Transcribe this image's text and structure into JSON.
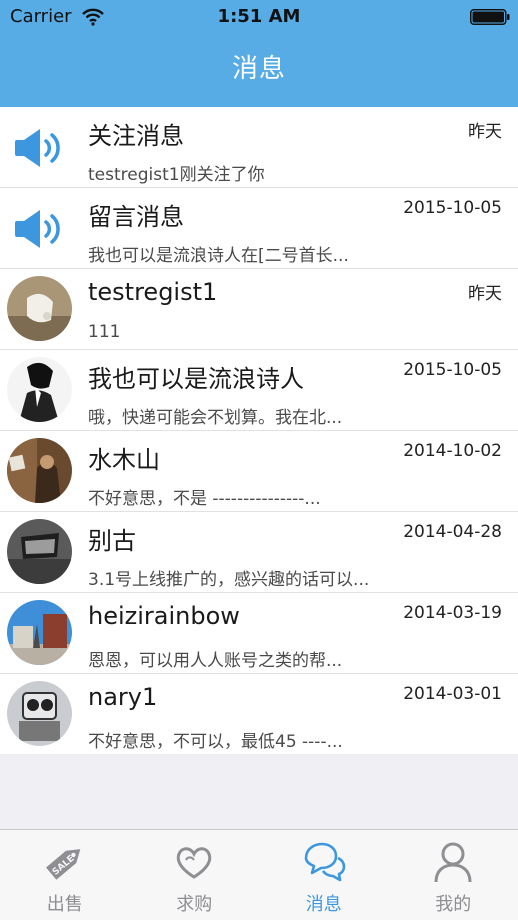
{
  "status_bar": {
    "carrier": "Carrier",
    "time": "1:51 AM"
  },
  "nav": {
    "title": "消息"
  },
  "messages": [
    {
      "avatar": "speaker-icon",
      "name": "关注消息",
      "time": "昨天",
      "preview": "testregist1刚关注了你"
    },
    {
      "avatar": "speaker-icon",
      "name": "留言消息",
      "time": "2015-10-05",
      "preview": "我也可以是流浪诗人在[二号首长..."
    },
    {
      "avatar": "photo",
      "name": "testregist1",
      "time": "昨天",
      "preview": "111"
    },
    {
      "avatar": "photo",
      "name": "我也可以是流浪诗人",
      "time": "2015-10-05",
      "preview": "哦，快递可能会不划算。我在北..."
    },
    {
      "avatar": "photo",
      "name": "水木山",
      "time": "2014-10-02",
      "preview": "不好意思，不是 ---------------..."
    },
    {
      "avatar": "photo",
      "name": "别古",
      "time": "2014-04-28",
      "preview": "3.1号上线推广的，感兴趣的话可以..."
    },
    {
      "avatar": "photo",
      "name": "heizirainbow",
      "time": "2014-03-19",
      "preview": "恩恩，可以用人人账号之类的帮..."
    },
    {
      "avatar": "photo",
      "name": "nary1",
      "time": "2014-03-01",
      "preview": "不好意思，不可以，最低45 ----..."
    }
  ],
  "tabs": [
    {
      "label": "出售",
      "icon": "sale-tag-icon",
      "icon_text": "SALE",
      "active": false
    },
    {
      "label": "求购",
      "icon": "heart-icon",
      "active": false
    },
    {
      "label": "消息",
      "icon": "chat-bubbles-icon",
      "active": true
    },
    {
      "label": "我的",
      "icon": "person-icon",
      "active": false
    }
  ],
  "colors": {
    "header": "#57ace6",
    "accent": "#3d97df",
    "inactive": "#8e8e93"
  }
}
